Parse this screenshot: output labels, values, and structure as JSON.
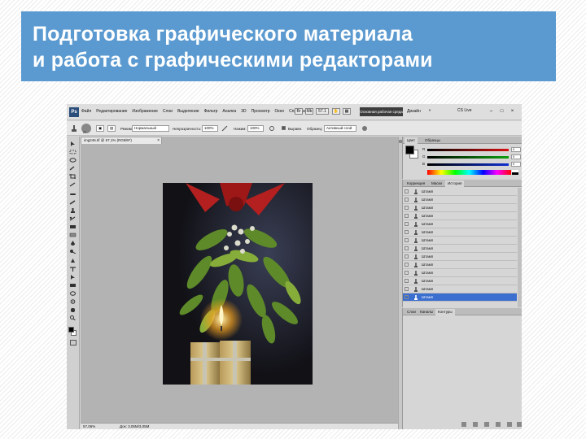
{
  "slide": {
    "title_line1": "Подготовка графического материала",
    "title_line2": "и работа с графическими редакторами"
  },
  "photoshop": {
    "logo": "Ps",
    "menu": [
      "Файл",
      "Редактирование",
      "Изображение",
      "Слои",
      "Выделение",
      "Фильтр",
      "Анализ",
      "3D",
      "Просмотр",
      "Окно",
      "Справка"
    ],
    "zoom_menu": "57.1",
    "workspace_button": "Основная рабочая среда",
    "design_label": "Дизайн",
    "cs_live": "CS Live",
    "window_controls": [
      "–",
      "□",
      "×"
    ],
    "options": {
      "brush_size": "27",
      "mode_label": "Режим:",
      "mode_value": "Нормальный",
      "opacity_label": "Непрозрачность:",
      "opacity_value": "100%",
      "pressure_label": "Нажим:",
      "pressure_value": "100%",
      "align_label": "Выравн.",
      "sample_label": "Образец:",
      "sample_value": "Активный слой"
    },
    "document": {
      "tab_title": "img246.tif @ 57,1% (RGB/8*)",
      "close": "×"
    },
    "status": {
      "zoom": "57,06%",
      "doc_info": "Док: 3,05M/3,05M"
    },
    "color_panel": {
      "tabs": [
        "Цвет",
        "Образцы"
      ],
      "channels": [
        {
          "label": "R",
          "value": "0",
          "color": "#d81010"
        },
        {
          "label": "G",
          "value": "0",
          "color": "#10a010"
        },
        {
          "label": "B",
          "value": "0",
          "color": "#1030d0"
        }
      ]
    },
    "history_panel": {
      "tabs": [
        "Коррекция",
        "Маски",
        "История"
      ],
      "items": [
        "Штамп",
        "Штамп",
        "Штамп",
        "Штамп",
        "Штамп",
        "Штамп",
        "Штамп",
        "Штамп",
        "Штамп",
        "Штамп",
        "Штамп",
        "Штамп",
        "Штамп",
        "Штамп"
      ],
      "selected_index": 13
    },
    "layers_panel": {
      "tabs": [
        "Слои",
        "Каналы",
        "Контуры"
      ]
    }
  }
}
